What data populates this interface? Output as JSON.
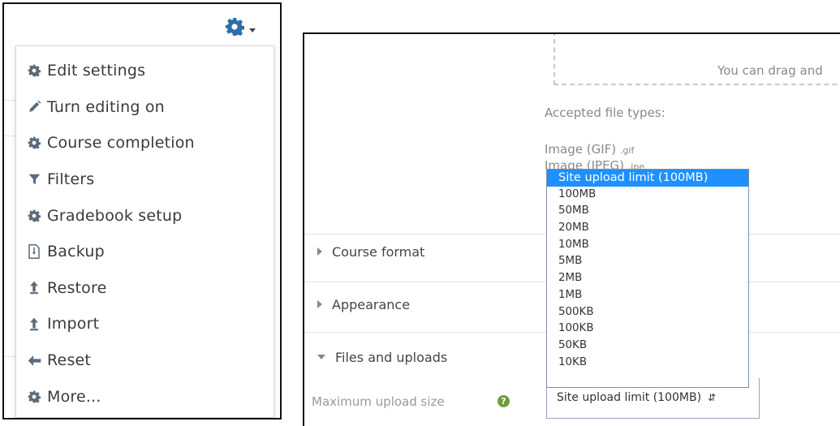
{
  "action_menu": {
    "items": [
      {
        "label": "Edit settings",
        "icon": "gear-icon"
      },
      {
        "label": "Turn editing on",
        "icon": "pencil-icon"
      },
      {
        "label": "Course completion",
        "icon": "gear-icon"
      },
      {
        "label": "Filters",
        "icon": "filter-icon"
      },
      {
        "label": "Gradebook setup",
        "icon": "gear-icon"
      },
      {
        "label": "Backup",
        "icon": "backup-file-icon"
      },
      {
        "label": "Restore",
        "icon": "upload-arrow-icon"
      },
      {
        "label": "Import",
        "icon": "upload-arrow-icon"
      },
      {
        "label": "Reset",
        "icon": "arrow-left-icon"
      },
      {
        "label": "More...",
        "icon": "gear-icon"
      }
    ]
  },
  "form": {
    "dropzone_text": "You can drag and",
    "accepted_title": "Accepted file types:",
    "filetypes": [
      {
        "name": "Image (GIF)",
        "ext": ".gif"
      },
      {
        "name": "Image (JPEG)",
        "ext": ".jpe"
      }
    ],
    "sections": [
      {
        "label": "Course format",
        "expanded": false
      },
      {
        "label": "Appearance",
        "expanded": false
      },
      {
        "label": "Files and uploads",
        "expanded": true
      }
    ],
    "max_upload": {
      "label": "Maximum upload size",
      "selected": "Site upload limit (100MB)",
      "options": [
        "Site upload limit (100MB)",
        "100MB",
        "50MB",
        "20MB",
        "10MB",
        "5MB",
        "2MB",
        "1MB",
        "500KB",
        "100KB",
        "50KB",
        "10KB"
      ]
    }
  },
  "colors": {
    "icon": "#5c6b7a",
    "gear": "#2e6ea6",
    "highlight": "#1e90ff",
    "help": "#6f9e3a"
  }
}
